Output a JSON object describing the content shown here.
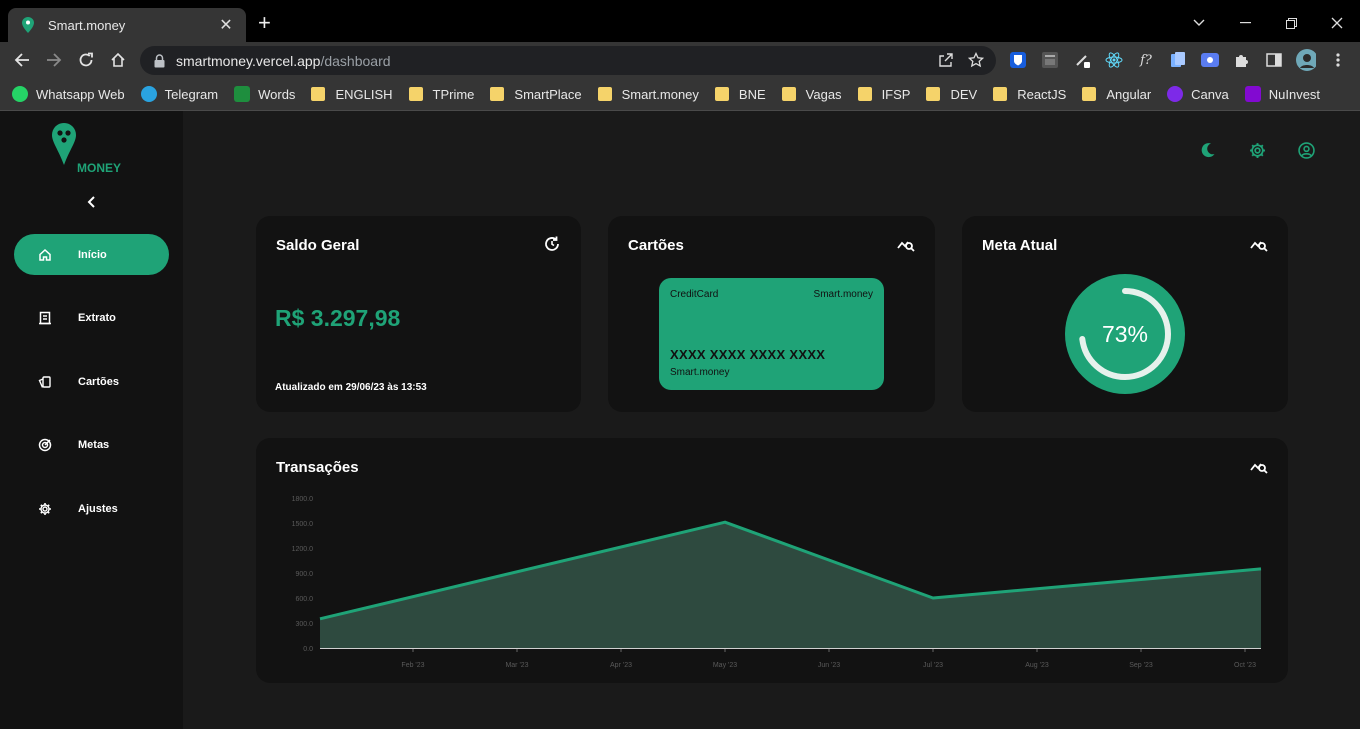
{
  "browser": {
    "tab_title": "Smart.money",
    "url_host": "smartmoney.vercel.app",
    "url_path": "/dashboard",
    "bookmarks": [
      {
        "label": "Whatsapp Web",
        "icon": "whatsapp-icon",
        "color": "#25d366"
      },
      {
        "label": "Telegram",
        "icon": "telegram-icon",
        "color": "#2aa3e0"
      },
      {
        "label": "Words",
        "icon": "sheets-icon",
        "color": "#1e8e3e"
      },
      {
        "label": "ENGLISH",
        "icon": "folder-icon"
      },
      {
        "label": "TPrime",
        "icon": "folder-icon"
      },
      {
        "label": "SmartPlace",
        "icon": "folder-icon"
      },
      {
        "label": "Smart.money",
        "icon": "folder-icon"
      },
      {
        "label": "BNE",
        "icon": "folder-icon"
      },
      {
        "label": "Vagas",
        "icon": "folder-icon"
      },
      {
        "label": "IFSP",
        "icon": "folder-icon"
      },
      {
        "label": "DEV",
        "icon": "folder-icon"
      },
      {
        "label": "ReactJS",
        "icon": "folder-icon"
      },
      {
        "label": "Angular",
        "icon": "folder-icon"
      },
      {
        "label": "Canva",
        "icon": "canva-icon",
        "color": "#7d2ae8"
      },
      {
        "label": "NuInvest",
        "icon": "nuinvest-icon",
        "color": "#820ad1"
      }
    ]
  },
  "brand": {
    "accent": "#1fa377",
    "logo_text": "MONEY"
  },
  "sidebar": {
    "items": [
      {
        "label": "Início",
        "icon": "home-icon",
        "active": true
      },
      {
        "label": "Extrato",
        "icon": "receipt-icon",
        "active": false
      },
      {
        "label": "Cartões",
        "icon": "cards-icon",
        "active": false
      },
      {
        "label": "Metas",
        "icon": "target-icon",
        "active": false
      },
      {
        "label": "Ajustes",
        "icon": "gear-icon",
        "active": false
      }
    ]
  },
  "header_icons": [
    "moon-icon",
    "gear-icon",
    "user-icon"
  ],
  "saldo": {
    "title": "Saldo Geral",
    "value": "R$ 3.297,98",
    "updated": "Atualizado em 29/06/23 às 13:53"
  },
  "cartoes": {
    "title": "Cartões",
    "card_type": "CreditCard",
    "card_brand": "Smart.money",
    "card_number": "XXXX XXXX XXXX XXXX",
    "card_holder": "Smart.money"
  },
  "meta": {
    "title": "Meta Atual",
    "percent_label": "73%",
    "percent": 0.73
  },
  "transacoes": {
    "title": "Transações"
  },
  "chart_data": {
    "type": "area",
    "x": [
      "Feb '23",
      "Mar '23",
      "Apr '23",
      "May '23",
      "Jun '23",
      "Jul '23",
      "Aug '23",
      "Sep '23",
      "Oct '23"
    ],
    "y_ticks": [
      "0.0",
      "300.0",
      "600.0",
      "900.0",
      "1200.0",
      "1500.0",
      "1800.0"
    ],
    "ylim": [
      0,
      1800
    ],
    "points": [
      {
        "x": "Jan '23",
        "y": 350
      },
      {
        "x": "May '23",
        "y": 1510
      },
      {
        "x": "Jul '23",
        "y": 600
      },
      {
        "x": "Oct '23",
        "y": 950
      }
    ],
    "line_color": "#1fa377",
    "fill_color": "#2e4a3f",
    "grid": false
  }
}
